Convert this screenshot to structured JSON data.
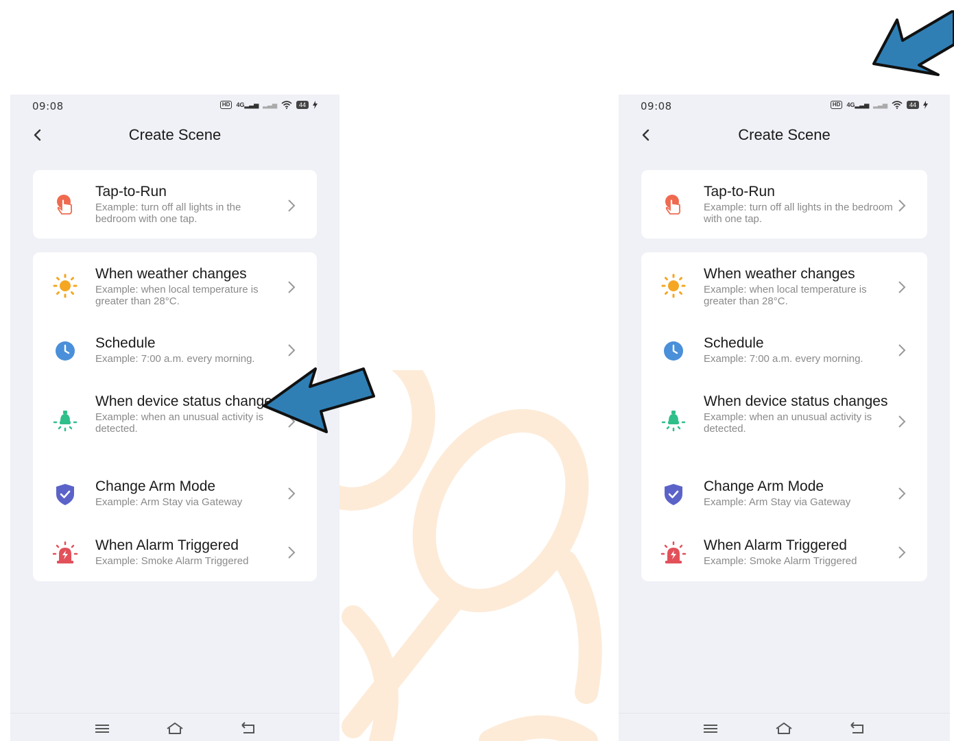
{
  "screens": [
    {
      "status": {
        "time": "09:08",
        "hd": "HD",
        "network": "4G",
        "battery": "44"
      },
      "header": {
        "title": "Create Scene"
      },
      "tap_card": {
        "name": "Tap-to-Run",
        "desc": "Example: turn off all lights in the bedroom with one tap.",
        "icon": "tap-hand-icon"
      },
      "items": [
        {
          "name": "When weather changes",
          "desc": "Example: when local temperature is greater than 28°C.",
          "icon": "sun-icon"
        },
        {
          "name": "Schedule",
          "desc": "Example: 7:00 a.m. every morning.",
          "icon": "clock-icon"
        },
        {
          "name": "When device status changes",
          "desc": "Example: when an unusual activity is detected.",
          "icon": "bulb-icon"
        },
        {
          "name": "Change Arm Mode",
          "desc": "Example: Arm Stay via Gateway",
          "icon": "shield-check-icon"
        },
        {
          "name": "When Alarm Triggered",
          "desc": "Example: Smoke Alarm Triggered",
          "icon": "siren-icon"
        }
      ]
    },
    {
      "status": {
        "time": "09:08",
        "hd": "HD",
        "network": "4G",
        "battery": "44"
      },
      "header": {
        "title": "Create Scene"
      },
      "tap_card": {
        "name": "Tap-to-Run",
        "desc": "Example: turn off all lights in the bedroom with one tap.",
        "icon": "tap-hand-icon"
      },
      "items": [
        {
          "name": "When weather changes",
          "desc": "Example: when local temperature is greater than 28°C.",
          "icon": "sun-icon"
        },
        {
          "name": "Schedule",
          "desc": "Example: 7:00 a.m. every morning.",
          "icon": "clock-icon"
        },
        {
          "name": "When device status changes",
          "desc": "Example: when an unusual activity is detected.",
          "icon": "bulb-icon"
        },
        {
          "name": "Change Arm Mode",
          "desc": "Example: Arm Stay via Gateway",
          "icon": "shield-check-icon"
        },
        {
          "name": "When Alarm Triggered",
          "desc": "Example: Smoke Alarm Triggered",
          "icon": "siren-icon"
        }
      ]
    }
  ],
  "colors": {
    "accent_arrow": "#2f7fb5",
    "tap_icon": "#ef6a4f",
    "sun_icon": "#f5a623",
    "clock_icon": "#4a8fd9",
    "bulb_icon": "#2fbf8a",
    "shield_icon": "#5b63c9",
    "siren_icon": "#e2515a",
    "screen_bg": "#f0f1f6",
    "deco": "#fdebd8"
  }
}
